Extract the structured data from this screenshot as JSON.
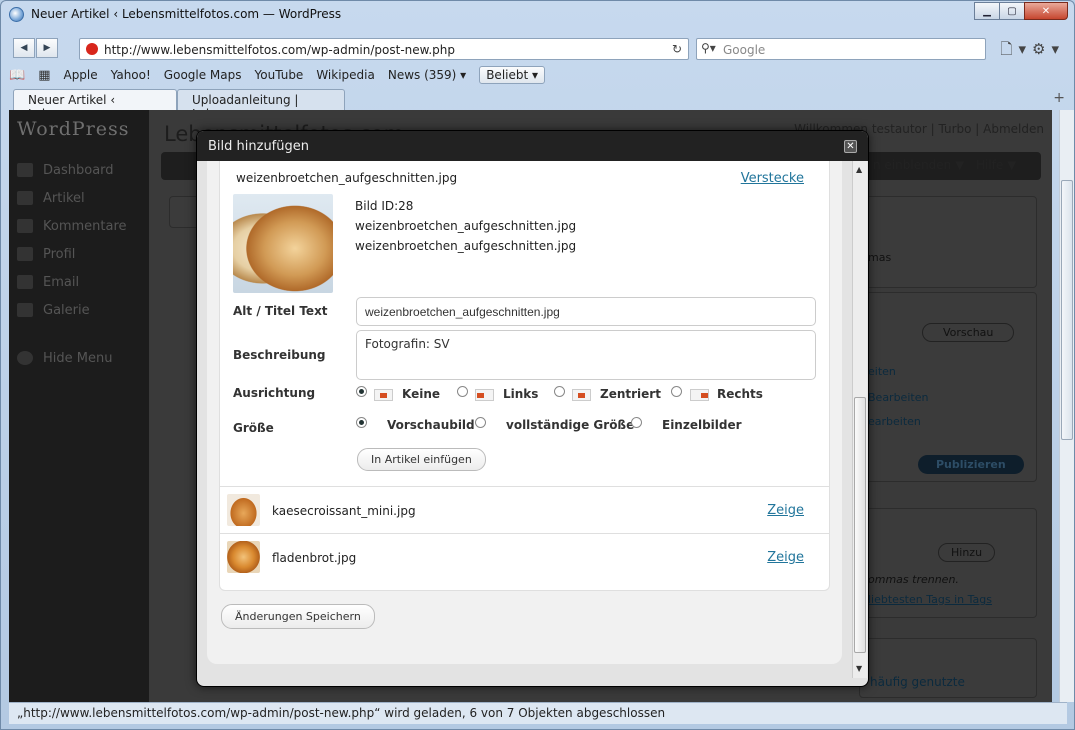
{
  "browser": {
    "title": "Neuer Artikel ‹ Lebensmittelfotos.com — WordPress",
    "url": "http://www.lebensmittelfotos.com/wp-admin/post-new.php",
    "search_placeholder": "Google",
    "bookmarks": [
      "Apple",
      "Yahoo!",
      "Google Maps",
      "YouTube",
      "Wikipedia",
      "News (359)"
    ],
    "bookmark_dropdown": "Beliebt",
    "tabs": [
      "Neuer Artikel ‹ Lebens...",
      "Uploadanleitung | Lebe..."
    ],
    "status": "„http://www.lebensmittelfotos.com/wp-admin/post-new.php“ wird geladen, 6 von 7 Objekten abgeschlossen"
  },
  "wordpress": {
    "logo": "WordPress",
    "site_title": "Lebensmittelfotos.com",
    "menu": [
      "Dashboard",
      "Artikel",
      "Kommentare",
      "Profil",
      "Email",
      "Galerie"
    ],
    "hide_menu": "Hide Menu",
    "user_bar": "Willkommen testautor | Turbo | Abmelden",
    "help_bar": [
      "n einblenden ▼",
      "Hilfe ▼"
    ],
    "right_panel": {
      "preview": "Vorschau",
      "publish": "Publizieren",
      "add": "Hinzu",
      "tags_hint": "ommas trennen.",
      "tags_link": "liebtesten Tags in Tags",
      "frequent": "häufig genutzte",
      "mas": "mas",
      "edit_links": [
        "eiten",
        "Bearbeiten",
        "earbeiten"
      ]
    }
  },
  "modal": {
    "title": "Bild hinzufügen",
    "current_file": "weizenbroetchen_aufgeschnitten.jpg",
    "hide_link": "Verstecke",
    "meta": {
      "id": "Bild ID:28",
      "file1": "weizenbroetchen_aufgeschnitten.jpg",
      "file2": "weizenbroetchen_aufgeschnitten.jpg"
    },
    "fields": {
      "alt_label": "Alt / Titel Text",
      "alt_value": "weizenbroetchen_aufgeschnitten.jpg",
      "desc_label": "Beschreibung",
      "desc_value": "Fotografin: SV",
      "align_label": "Ausrichtung",
      "align_options": [
        "Keine",
        "Links",
        "Zentriert",
        "Rechts"
      ],
      "size_label": "Größe",
      "size_options": [
        "Vorschaubild",
        "vollständige Größe",
        "Einzelbilder"
      ],
      "insert_button": "In Artikel einfügen"
    },
    "other_images": [
      {
        "name": "kaesecroissant_mini.jpg",
        "action": "Zeige"
      },
      {
        "name": "fladenbrot.jpg",
        "action": "Zeige"
      }
    ],
    "save_button": "Änderungen Speichern"
  }
}
